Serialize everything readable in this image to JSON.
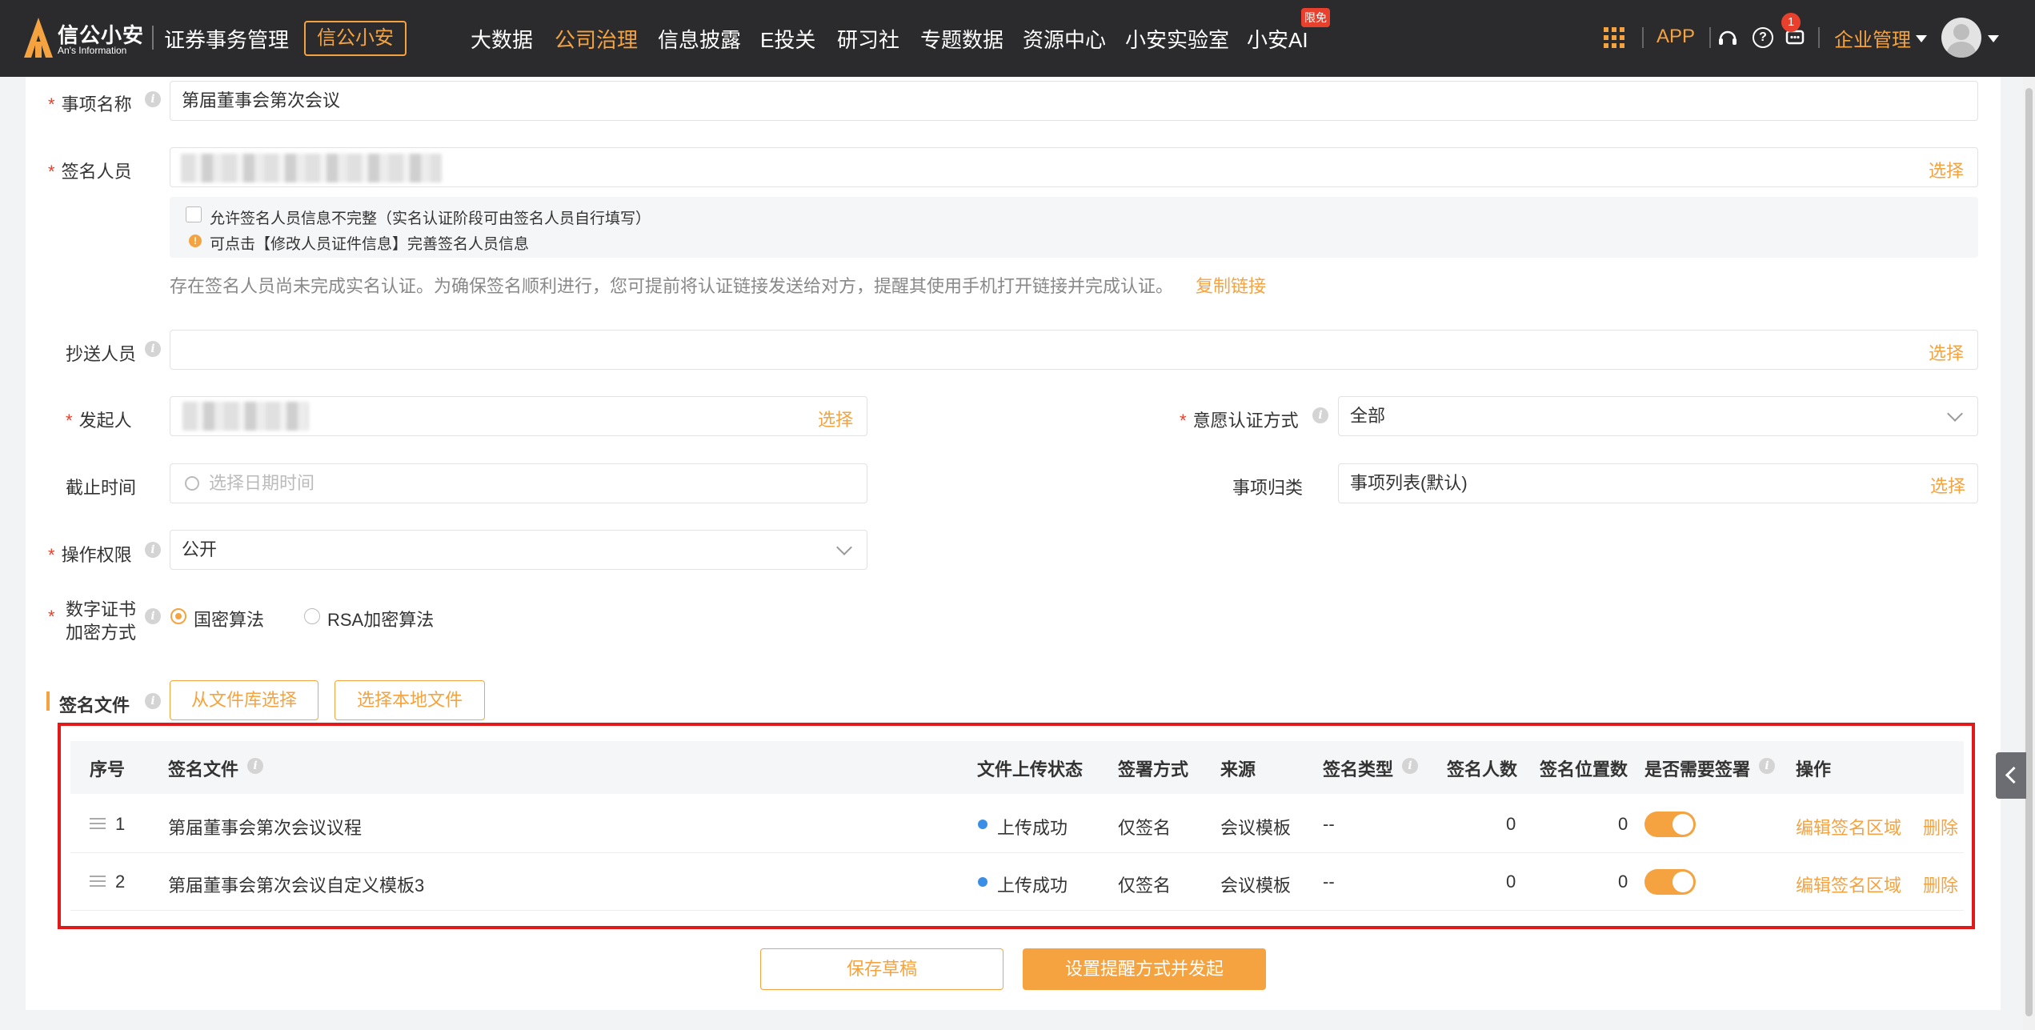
{
  "header": {
    "logo_text": "信公小安",
    "logo_sub": "An's Information",
    "module_title": "证券事务管理",
    "brand_button": "信公小安",
    "nav": [
      "大数据",
      "公司治理",
      "信息披露",
      "E投关",
      "研习社",
      "专题数据",
      "资源中心",
      "小安实验室",
      "小安AI"
    ],
    "active_nav": "公司治理",
    "nav_badge": "限免",
    "app_label": "APP",
    "notification_count": "1",
    "company_menu": "企业管理"
  },
  "form": {
    "item_name": {
      "label": "事项名称",
      "value": "第届董事会第次会议"
    },
    "signers": {
      "label": "签名人员",
      "select": "选择"
    },
    "allow_incomplete": "允许签名人员信息不完整（实名认证阶段可由签名人员自行填写）",
    "edit_hint": "可点击【修改人员证件信息】完善签名人员信息",
    "auth_note": "存在签名人员尚未完成实名认证。为确保签名顺利进行，您可提前将认证链接发送给对方，提醒其使用手机打开链接并完成认证。",
    "copy_link": "复制链接",
    "cc": {
      "label": "抄送人员",
      "select": "选择"
    },
    "initiator": {
      "label": "发起人",
      "select": "选择"
    },
    "intent_auth": {
      "label": "意愿认证方式",
      "value": "全部"
    },
    "deadline": {
      "label": "截止时间",
      "placeholder": "选择日期时间"
    },
    "category": {
      "label": "事项归类",
      "value": "事项列表(默认)",
      "select": "选择"
    },
    "permission": {
      "label": "操作权限",
      "value": "公开"
    },
    "cert_encryption": {
      "label_line1": "数字证书",
      "label_line2": "加密方式",
      "options": [
        "国密算法",
        "RSA加密算法"
      ],
      "selected": "国密算法"
    }
  },
  "files_section": {
    "title": "签名文件",
    "btn_from_library": "从文件库选择",
    "btn_local": "选择本地文件",
    "columns": [
      "序号",
      "签名文件",
      "文件上传状态",
      "签署方式",
      "来源",
      "签名类型",
      "签名人数",
      "签名位置数",
      "是否需要签署",
      "操作"
    ],
    "rows": [
      {
        "index": "1",
        "file": "第届董事会第次会议议程",
        "status": "上传成功",
        "method": "仅签名",
        "source": "会议模板",
        "type": "--",
        "signer_count": "0",
        "position_count": "0",
        "need_sign": true,
        "edit": "编辑签名区域",
        "delete": "删除"
      },
      {
        "index": "2",
        "file": "第届董事会第次会议自定义模板3",
        "status": "上传成功",
        "method": "仅签名",
        "source": "会议模板",
        "type": "--",
        "signer_count": "0",
        "position_count": "0",
        "need_sign": true,
        "edit": "编辑签名区域",
        "delete": "删除"
      }
    ]
  },
  "footer": {
    "save_draft": "保存草稿",
    "submit": "设置提醒方式并发起"
  },
  "colors": {
    "accent": "#f5a340",
    "topbar": "#2b2b2e",
    "required": "#e8402c",
    "highlight_frame": "#e01a1a",
    "status_dot": "#3a8ee6"
  }
}
